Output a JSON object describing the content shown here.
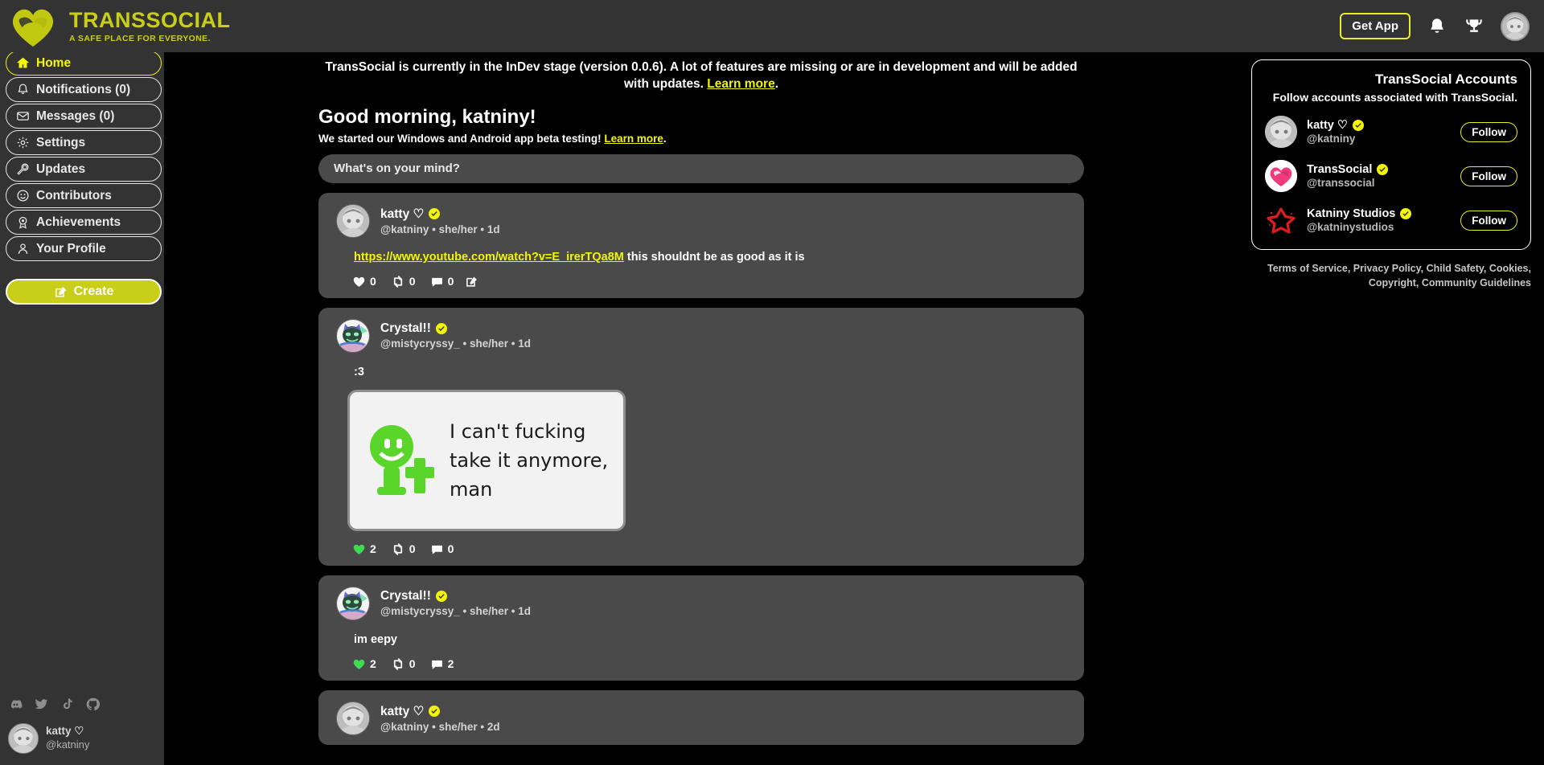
{
  "colors": {
    "accent_yellow": "#e8ef20",
    "brand_olive": "#c9ce18",
    "link_yellow": "#f2f505",
    "panel_gray": "#4a4a4a",
    "chrome_gray": "#333333",
    "page_black": "#000000",
    "liked_green": "#3ddc50"
  },
  "header": {
    "brand_name": "TRANSSOCIAL",
    "brand_tagline": "A SAFE PLACE FOR EVERYONE.",
    "logo_icon": "heart-logo-icon",
    "get_app_label": "Get App",
    "bell_icon": "bell-icon",
    "trophy_icon": "trophy-icon",
    "avatar_icon": "user-avatar"
  },
  "sidebar": {
    "items": [
      {
        "label": "Home",
        "icon": "home-icon",
        "active": true
      },
      {
        "label": "Notifications (0)",
        "icon": "bell-icon",
        "active": false
      },
      {
        "label": "Messages (0)",
        "icon": "envelope-icon",
        "active": false
      },
      {
        "label": "Settings",
        "icon": "gear-icon",
        "active": false
      },
      {
        "label": "Updates",
        "icon": "wrench-icon",
        "active": false
      },
      {
        "label": "Contributors",
        "icon": "smiley-icon",
        "active": false
      },
      {
        "label": "Achievements",
        "icon": "award-icon",
        "active": false
      },
      {
        "label": "Your Profile",
        "icon": "person-icon",
        "active": false
      }
    ],
    "create_label": "Create",
    "create_icon": "pencil-square-icon",
    "socials": [
      {
        "name": "discord-icon"
      },
      {
        "name": "twitter-icon"
      },
      {
        "name": "tiktok-icon"
      },
      {
        "name": "github-icon"
      }
    ],
    "current_user": {
      "display_name": "katty ♡",
      "handle": "@katniny"
    }
  },
  "main": {
    "dev_notice": {
      "text_before": "TransSocial is currently in the InDev stage (version 0.0.6). A lot of features are missing or are in development and will be added with updates. ",
      "link_label": "Learn more",
      "text_after": "."
    },
    "greeting": "Good morning, katniny!",
    "greeting_sub": {
      "text_before": "We started our Windows and Android app beta testing! ",
      "link_label": "Learn more",
      "text_after": "."
    },
    "composer": {
      "placeholder": "What's on your mind?",
      "value": ""
    },
    "posts": [
      {
        "avatar": "katty-avatar",
        "display_name": "katty ♡",
        "verified": true,
        "handle": "@katniny",
        "pronouns": "she/her",
        "age": "1d",
        "meta": "@katniny • she/her • 1d",
        "link_text": "https://www.youtube.com/watch?v=E_irerTQa8M",
        "body_text": " this shouldnt be as good as it is",
        "likes": "0",
        "liked": false,
        "reposts": "0",
        "comments": "0",
        "has_edit": true
      },
      {
        "avatar": "crystal-avatar",
        "display_name": "Crystal!!",
        "verified": true,
        "handle": "@mistycryssy_",
        "pronouns": "she/her",
        "age": "1d",
        "meta": "@mistycryssy_ • she/her • 1d",
        "body_text": ":3",
        "media": {
          "icon": "green-smiley-plus-icon",
          "caption": "I can't fucking take it anymore, man"
        },
        "likes": "2",
        "liked": true,
        "reposts": "0",
        "comments": "0",
        "has_edit": false
      },
      {
        "avatar": "crystal-avatar",
        "display_name": "Crystal!!",
        "verified": true,
        "handle": "@mistycryssy_",
        "pronouns": "she/her",
        "age": "1d",
        "meta": "@mistycryssy_ • she/her • 1d",
        "body_text": "im eepy",
        "likes": "2",
        "liked": true,
        "reposts": "0",
        "comments": "2",
        "has_edit": false
      },
      {
        "avatar": "katty-avatar",
        "display_name": "katty ♡",
        "verified": true,
        "handle": "@katniny",
        "pronouns": "she/her",
        "age": "2d",
        "meta": "@katniny • she/her • 2d",
        "body_text": "",
        "likes": "",
        "liked": false,
        "reposts": "",
        "comments": "",
        "has_edit": false
      }
    ]
  },
  "right_sidebar": {
    "accounts_title": "TransSocial Accounts",
    "accounts_sub": "Follow accounts associated with TransSocial.",
    "accounts": [
      {
        "avatar": "katty-avatar",
        "name": "katty ♡",
        "handle": "@katniny",
        "verified": true,
        "follow_label": "Follow"
      },
      {
        "avatar": "transsocial-heart-avatar",
        "name": "TransSocial",
        "handle": "@transsocial",
        "verified": true,
        "follow_label": "Follow"
      },
      {
        "avatar": "katniny-studios-star-avatar",
        "name": "Katniny Studios",
        "handle": "@katninystudios",
        "verified": true,
        "follow_label": "Follow"
      }
    ],
    "legal_links": [
      "Terms of Service",
      "Privacy Policy",
      "Child Safety",
      "Cookies",
      "Copyright",
      "Community Guidelines"
    ]
  }
}
